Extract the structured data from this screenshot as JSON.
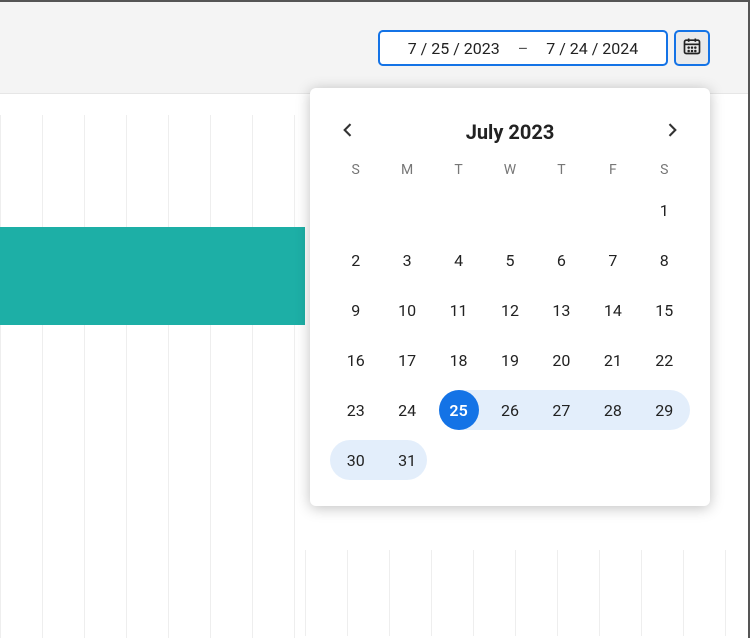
{
  "date_range": {
    "start": "7 / 25 / 2023",
    "separator": "–",
    "end": "7 / 24 / 2024"
  },
  "calendar": {
    "title": "July 2023",
    "dow": [
      "S",
      "M",
      "T",
      "W",
      "T",
      "F",
      "S"
    ],
    "selected_day": 25,
    "range": {
      "from": 25,
      "to": 31
    },
    "weeks": [
      [
        "",
        "",
        "",
        "",
        "",
        "",
        "1"
      ],
      [
        "2",
        "3",
        "4",
        "5",
        "6",
        "7",
        "8"
      ],
      [
        "9",
        "10",
        "11",
        "12",
        "13",
        "14",
        "15"
      ],
      [
        "16",
        "17",
        "18",
        "19",
        "20",
        "21",
        "22"
      ],
      [
        "23",
        "24",
        "25",
        "26",
        "27",
        "28",
        "29"
      ],
      [
        "30",
        "31",
        "",
        "",
        "",
        "",
        ""
      ]
    ]
  },
  "colors": {
    "accent": "#1473e6",
    "teal": "#1dafa6",
    "range": "#e3eefb"
  }
}
